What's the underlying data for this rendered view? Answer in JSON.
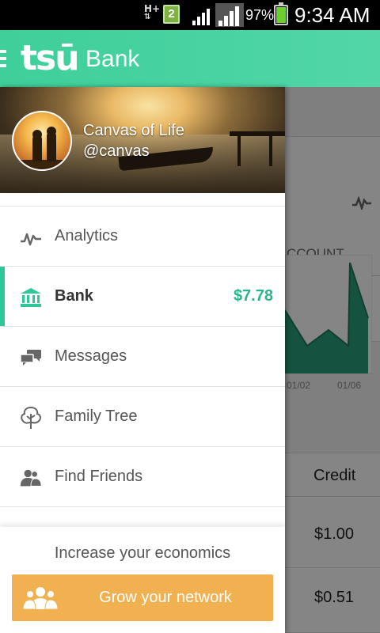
{
  "status_bar": {
    "network": "H+",
    "notification_count": "2",
    "battery_percent": "97%",
    "time": "9:34 AM"
  },
  "app_bar": {
    "logo": "tsū",
    "title": "Bank"
  },
  "background_page": {
    "tab_partial": "CCOUNT",
    "chart_axis": [
      "01/02",
      "01/06"
    ],
    "table_header": "Credit",
    "rows": [
      "$1.00",
      "$0.51"
    ]
  },
  "drawer": {
    "profile": {
      "name": "Canvas of Life",
      "handle": "@canvas"
    },
    "items": [
      {
        "label": "Analytics",
        "icon": "analytics-icon"
      },
      {
        "label": "Bank",
        "icon": "bank-icon",
        "amount": "$7.78",
        "active": true
      },
      {
        "label": "Messages",
        "icon": "messages-icon"
      },
      {
        "label": "Family Tree",
        "icon": "family-tree-icon"
      },
      {
        "label": "Find Friends",
        "icon": "find-friends-icon"
      }
    ],
    "footer": {
      "text": "Increase your economics",
      "button_label": "Grow your network"
    }
  },
  "colors": {
    "accent": "#3ecf9a",
    "amount": "#2ab58c",
    "button": "#f2b150"
  }
}
